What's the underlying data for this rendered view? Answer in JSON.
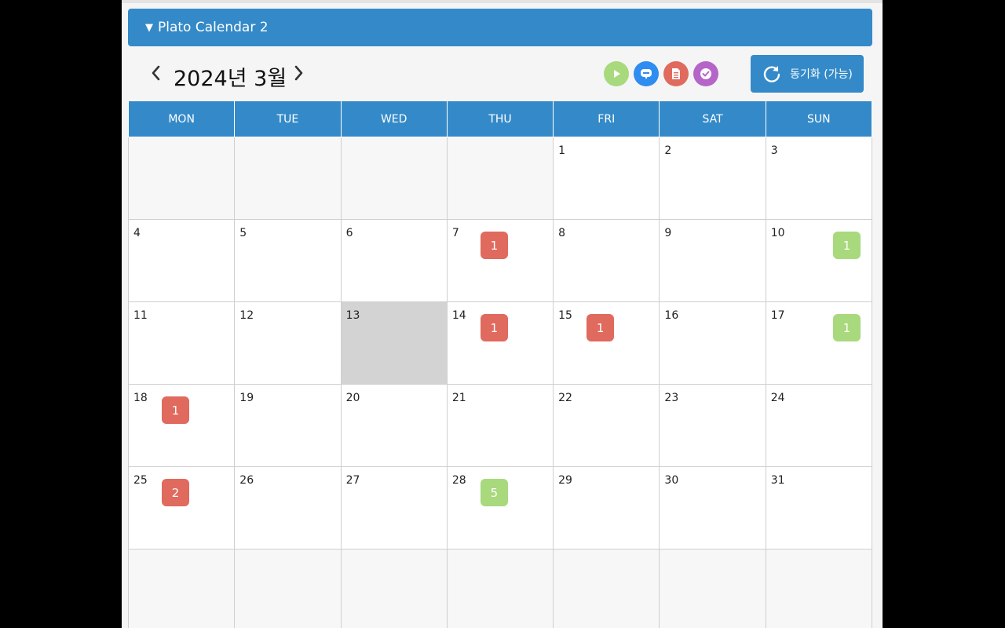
{
  "panel": {
    "title": "Plato Calendar 2",
    "toggle_icon": "triangle-down-icon"
  },
  "nav": {
    "prev_label": "‹",
    "next_label": "›",
    "month_title": "2024년 3월"
  },
  "tool_icons": [
    {
      "name": "play-icon",
      "color": "#a8d97c"
    },
    {
      "name": "chat-icon",
      "color": "#2f8cf0"
    },
    {
      "name": "document-icon",
      "color": "#e06a5e"
    },
    {
      "name": "check-icon",
      "color": "#b565c8"
    }
  ],
  "sync": {
    "label": "동기화 (가능)",
    "icon": "refresh-icon"
  },
  "weekdays": [
    "MON",
    "TUE",
    "WED",
    "THU",
    "FRI",
    "SAT",
    "SUN"
  ],
  "colors": {
    "accent": "#348ac8",
    "red_badge": "#e06a5e",
    "green_badge": "#a8d97c",
    "today": "#d3d3d3"
  },
  "today": 13,
  "weeks": [
    [
      {
        "day": ""
      },
      {
        "day": ""
      },
      {
        "day": ""
      },
      {
        "day": ""
      },
      {
        "day": "1"
      },
      {
        "day": "2"
      },
      {
        "day": "3"
      }
    ],
    [
      {
        "day": "4"
      },
      {
        "day": "5"
      },
      {
        "day": "6"
      },
      {
        "day": "7",
        "badge": "1",
        "badge_color": "red"
      },
      {
        "day": "8"
      },
      {
        "day": "9"
      },
      {
        "day": "10",
        "badge": "1",
        "badge_color": "green"
      }
    ],
    [
      {
        "day": "11"
      },
      {
        "day": "12"
      },
      {
        "day": "13"
      },
      {
        "day": "14",
        "badge": "1",
        "badge_color": "red"
      },
      {
        "day": "15",
        "badge": "1",
        "badge_color": "red"
      },
      {
        "day": "16"
      },
      {
        "day": "17",
        "badge": "1",
        "badge_color": "green"
      }
    ],
    [
      {
        "day": "18",
        "badge": "1",
        "badge_color": "red"
      },
      {
        "day": "19"
      },
      {
        "day": "20"
      },
      {
        "day": "21"
      },
      {
        "day": "22"
      },
      {
        "day": "23"
      },
      {
        "day": "24"
      }
    ],
    [
      {
        "day": "25",
        "badge": "2",
        "badge_color": "red"
      },
      {
        "day": "26"
      },
      {
        "day": "27"
      },
      {
        "day": "28",
        "badge": "5",
        "badge_color": "green"
      },
      {
        "day": "29"
      },
      {
        "day": "30"
      },
      {
        "day": "31"
      }
    ],
    [
      {
        "day": ""
      },
      {
        "day": ""
      },
      {
        "day": ""
      },
      {
        "day": ""
      },
      {
        "day": ""
      },
      {
        "day": ""
      },
      {
        "day": ""
      }
    ]
  ]
}
